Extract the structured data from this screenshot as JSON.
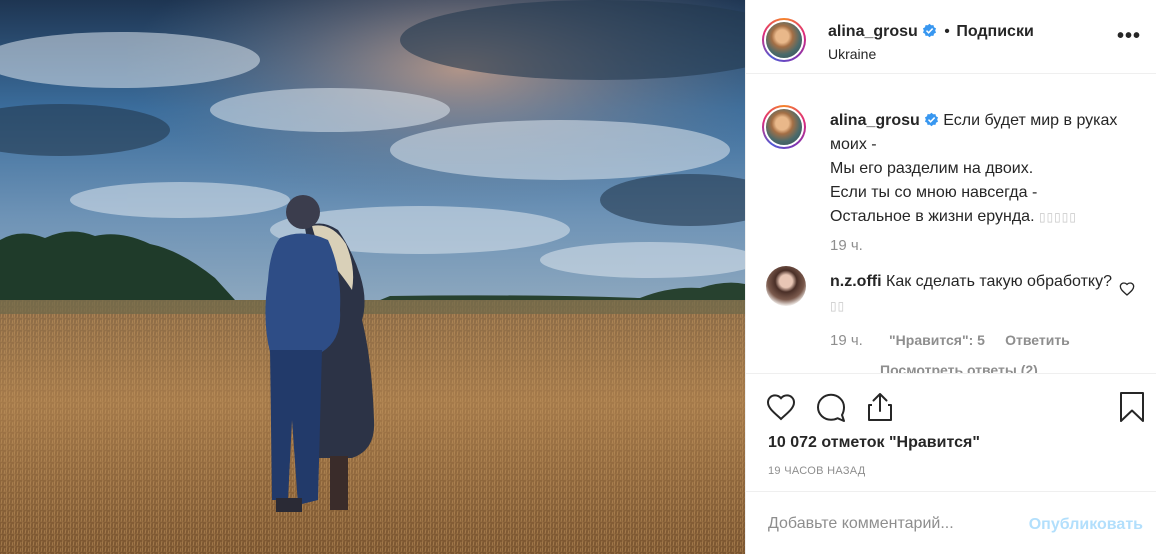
{
  "post": {
    "username": "alina_grosu",
    "separator": "•",
    "follow_label": "Подписки",
    "location": "Ukraine",
    "more_label": "•••",
    "colors": {
      "verified": "#3897f0",
      "publish_disabled": "#b2dffc",
      "muted": "#8e8e8e"
    }
  },
  "caption": {
    "username": "alina_grosu",
    "lines": [
      "Если будет мир в руках моих -",
      "Мы его разделим на двоих.",
      "Если ты со мною навсегда -",
      "Остальное в жизни ерунда."
    ],
    "time": "19 ч."
  },
  "comment": {
    "username": "n.z.offi",
    "text": "Как сделать такую обработку?",
    "time": "19 ч.",
    "likes_label": "\"Нравится\": 5",
    "reply_label": "Ответить",
    "view_replies_label": "Посмотреть ответы (2)"
  },
  "actions": {
    "like_icon": "heart-icon",
    "comment_icon": "comment-icon",
    "share_icon": "share-icon",
    "save_icon": "bookmark-icon",
    "likes_text": "10 072 отметок \"Нравится\"",
    "time_ago": "19 ЧАСОВ НАЗАД"
  },
  "add_comment": {
    "placeholder": "Добавьте комментарий...",
    "publish_label": "Опубликовать"
  }
}
